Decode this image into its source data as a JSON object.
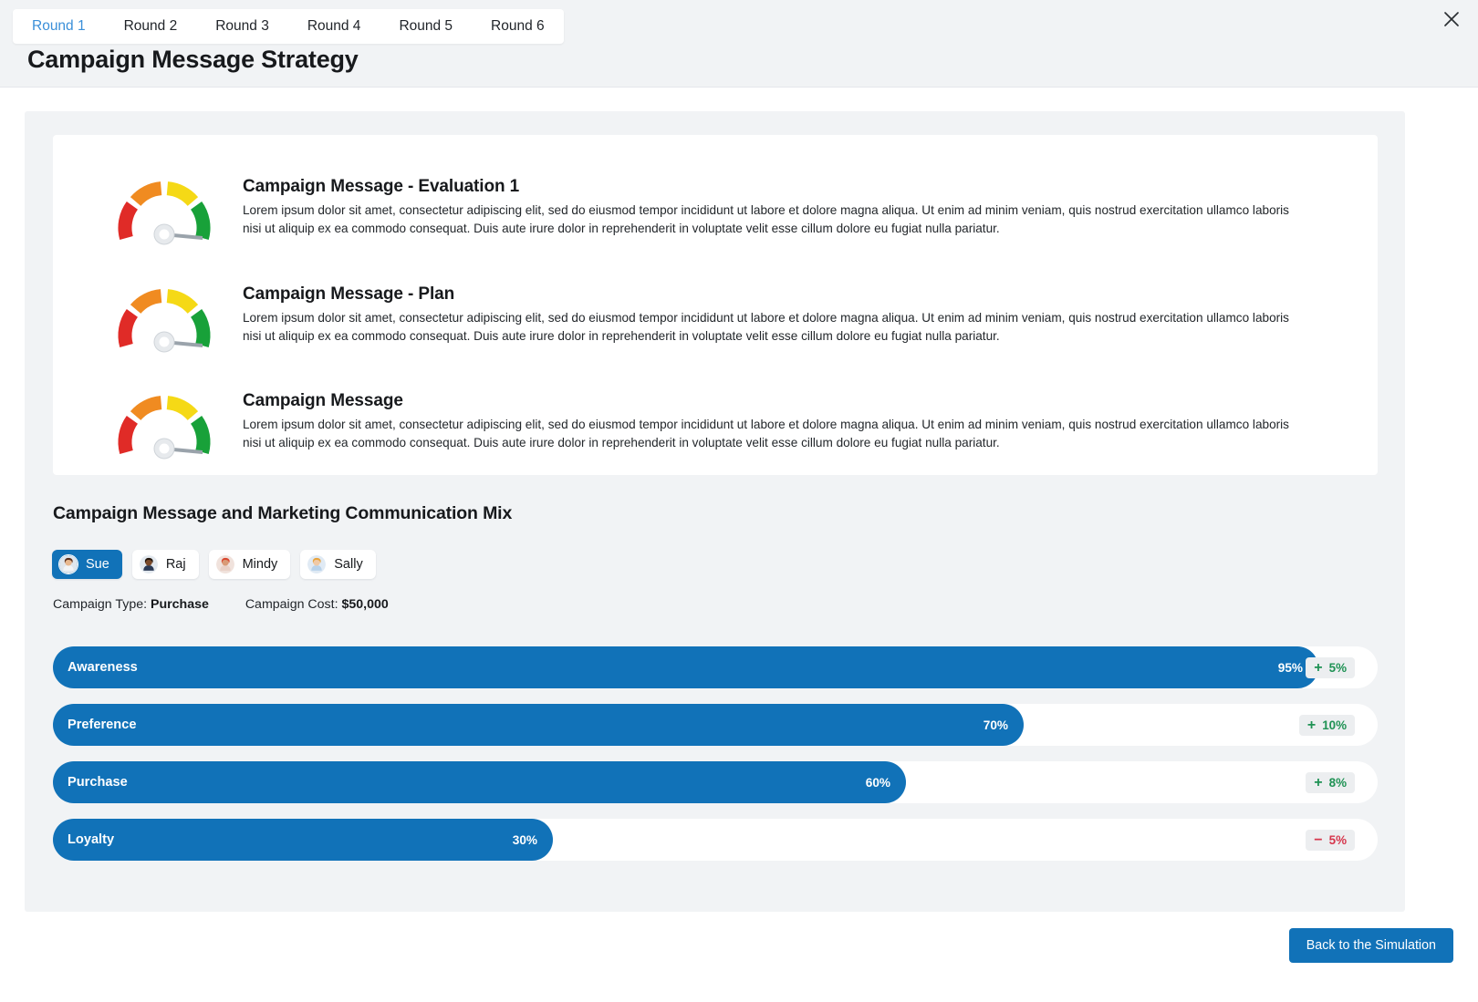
{
  "header": {
    "title": "Campaign Message Strategy",
    "close_label": "×",
    "tabs": [
      {
        "label": "Round 1",
        "active": true
      },
      {
        "label": "Round 2",
        "active": false
      },
      {
        "label": "Round 3",
        "active": false
      },
      {
        "label": "Round 4",
        "active": false
      },
      {
        "label": "Round 5",
        "active": false
      },
      {
        "label": "Round 6",
        "active": false
      }
    ]
  },
  "evaluations": [
    {
      "title": "Campaign Message - Evaluation 1",
      "body": "Lorem ipsum dolor sit amet, consectetur adipiscing elit, sed do eiusmod tempor incididunt ut labore et dolore magna aliqua. Ut enim ad minim veniam, quis nostrud exercitation ullamco laboris nisi ut aliquip ex ea commodo consequat. Duis aute irure dolor in reprehenderit in voluptate velit esse cillum dolore eu fugiat nulla pariatur.",
      "gauge_icon": "gauge-icon"
    },
    {
      "title": "Campaign Message - Plan",
      "body": "Lorem ipsum dolor sit amet, consectetur adipiscing elit, sed do eiusmod tempor incididunt ut labore et dolore magna aliqua. Ut enim ad minim veniam, quis nostrud exercitation ullamco laboris nisi ut aliquip ex ea commodo consequat. Duis aute irure dolor in reprehenderit in voluptate velit esse cillum dolore eu fugiat nulla pariatur.",
      "gauge_icon": "gauge-icon"
    },
    {
      "title": "Campaign Message",
      "body": "Lorem ipsum dolor sit amet, consectetur adipiscing elit, sed do eiusmod tempor incididunt ut labore et dolore magna aliqua. Ut enim ad minim veniam, quis nostrud exercitation ullamco laboris nisi ut aliquip ex ea commodo consequat. Duis aute irure dolor in reprehenderit in voluptate velit esse cillum dolore eu fugiat nulla pariatur.",
      "gauge_icon": "gauge-icon"
    }
  ],
  "mix": {
    "section_title": "Campaign Message and Marketing Communication Mix",
    "personas": [
      {
        "name": "Sue",
        "selected": true
      },
      {
        "name": "Raj",
        "selected": false
      },
      {
        "name": "Mindy",
        "selected": false
      },
      {
        "name": "Sally",
        "selected": false
      }
    ],
    "campaign_type_label": "Campaign Type:",
    "campaign_type_value": "Purchase",
    "campaign_cost_label": "Campaign Cost:",
    "campaign_cost_value": "$50,000",
    "bars": [
      {
        "label": "Awareness",
        "percent": 95,
        "percent_text": "95%",
        "delta_sign": "+",
        "delta_text": "5%",
        "direction": "up"
      },
      {
        "label": "Preference",
        "percent": 70,
        "percent_text": "70%",
        "delta_sign": "+",
        "delta_text": "10%",
        "direction": "up"
      },
      {
        "label": "Purchase",
        "percent": 60,
        "percent_text": "60%",
        "delta_sign": "+",
        "delta_text": "8%",
        "direction": "up"
      },
      {
        "label": "Loyalty",
        "percent": 30,
        "percent_text": "30%",
        "delta_sign": "−",
        "delta_text": "5%",
        "direction": "down"
      }
    ]
  },
  "footer": {
    "back_button": "Back to the Simulation"
  },
  "colors": {
    "accent": "#1172b8",
    "tab_active": "#3a8fd9",
    "page_bg": "#f1f3f5",
    "positive": "#1f9254",
    "negative": "#d6364c",
    "gauge_red": "#e02b27",
    "gauge_orange": "#f08b21",
    "gauge_yellow": "#f5d916",
    "gauge_green": "#18a139"
  }
}
